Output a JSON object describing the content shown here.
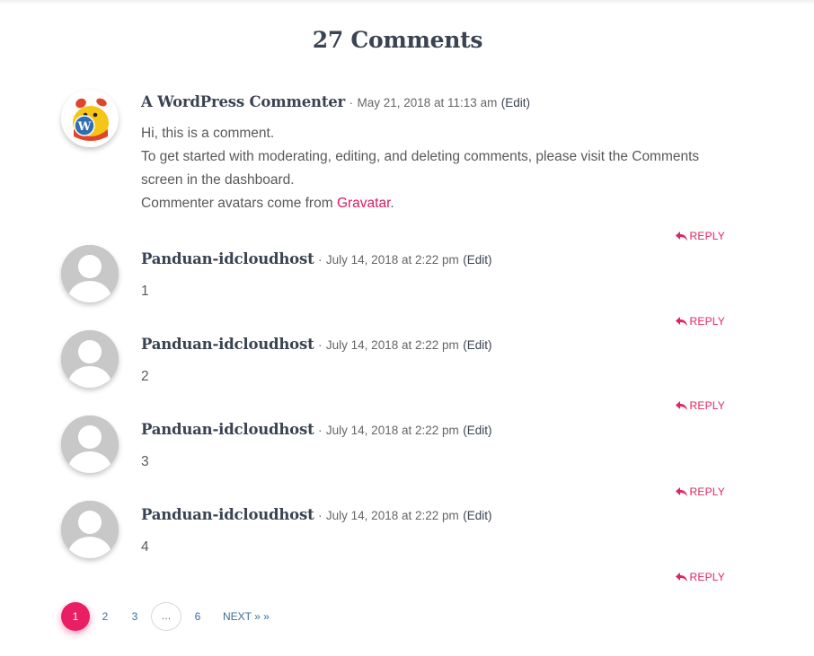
{
  "comments_title": "27 Comments",
  "comments": [
    {
      "author": "A WordPress Commenter",
      "separator": "·",
      "date": "May 21, 2018 at 11:13 am",
      "edit": "(Edit)",
      "avatar": "wapuu-wordpress-avatar",
      "body": {
        "line1": "Hi, this is a comment.",
        "line2": "To get started with moderating, editing, and deleting comments, please visit the Comments screen in the dashboard.",
        "line3_prefix": "Commenter avatars come from ",
        "line3_link": "Gravatar",
        "line3_suffix": "."
      },
      "reply": "REPLY"
    },
    {
      "author": "Panduan-idcloudhost",
      "separator": "·",
      "date": "July 14, 2018 at 2:22 pm",
      "edit": "(Edit)",
      "avatar": "default-user-avatar",
      "body": "1",
      "reply": "REPLY"
    },
    {
      "author": "Panduan-idcloudhost",
      "separator": "·",
      "date": "July 14, 2018 at 2:22 pm",
      "edit": "(Edit)",
      "avatar": "default-user-avatar",
      "body": "2",
      "reply": "REPLY"
    },
    {
      "author": "Panduan-idcloudhost",
      "separator": "·",
      "date": "July 14, 2018 at 2:22 pm",
      "edit": "(Edit)",
      "avatar": "default-user-avatar",
      "body": "3",
      "reply": "REPLY"
    },
    {
      "author": "Panduan-idcloudhost",
      "separator": "·",
      "date": "July 14, 2018 at 2:22 pm",
      "edit": "(Edit)",
      "avatar": "default-user-avatar",
      "body": "4",
      "reply": "REPLY"
    }
  ],
  "pagination": {
    "current": "1",
    "pages": [
      "2",
      "3"
    ],
    "dots": "…",
    "last": "6",
    "next": "NEXT » »"
  },
  "colors": {
    "accent": "#e91e63",
    "link": "#d81b60",
    "heading": "#3a4351",
    "text": "#595959",
    "avatar_placeholder": "#c8c8c8"
  }
}
